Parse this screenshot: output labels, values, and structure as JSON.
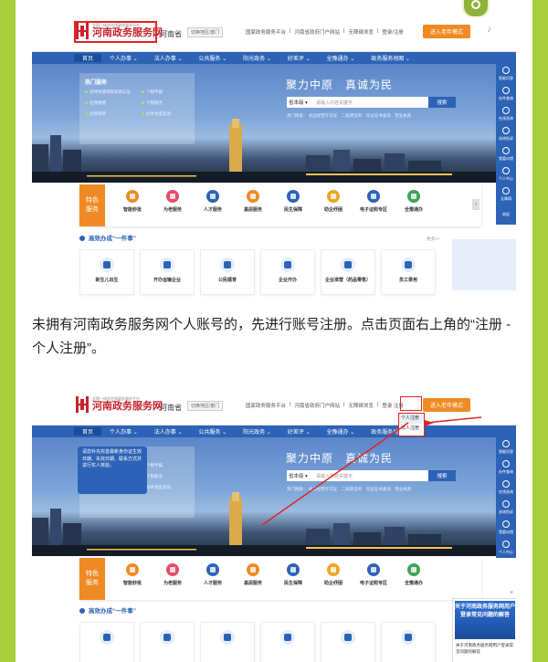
{
  "header": {
    "logo_tagline": "全国一体化在线政务服务平台",
    "logo_name": "河南政务服务网",
    "region": "河南省",
    "region_select": "切换地区/部门",
    "top_links": [
      "国家政务服务平台",
      "河南省政府门户网站",
      "无障碍浏览",
      "登录",
      "注册"
    ],
    "elder_mode": "进入老年模式"
  },
  "registration_dropdown": [
    "个人注册",
    "法人注册"
  ],
  "nav": [
    "首页",
    "个人办事 ⌄",
    "法人办事 ⌄",
    "公共服务 ⌄",
    "阳光政务 ⌄",
    "好差评 ⌄",
    "全豫通办 ⌄",
    "政务服务地图 ⌄"
  ],
  "hero": {
    "slogan": "聚力中原　真诚为民",
    "search_scope": "省本级 ▾",
    "search_placeholder": "请输入内容关键字",
    "search_button": "搜索",
    "hot_search": "热门搜索：  食品经营许可证　二级建造师　毕业证书查询　营业执照"
  },
  "hot_services": {
    "title": "热门服务",
    "items": [
      "退休待遇领取资格认证",
      "个税申报",
      "社保缴费",
      "个税服务",
      "社保转移",
      "办件进度查询"
    ]
  },
  "tip_popup": "请您补充完善最新身份证生效日期、失效日期、联系方式并进行实人核验。",
  "right_rail": [
    "智能问答",
    "办件查询",
    "在线咨询",
    "咨询投诉",
    "我要纠错",
    "个人中心",
    "无障碍",
    "收起"
  ],
  "featured": {
    "label": "特色\n服务",
    "items": [
      "智能秒批",
      "为老服务",
      "人才服务",
      "基层服务",
      "民生保障",
      "助企纾困",
      "电子证照专区",
      "全豫通办"
    ]
  },
  "efficient": {
    "title": "高效办成“一件事”",
    "more": "更多>>",
    "cards": [
      "新生儿出生",
      "开办运输企业",
      "公民婚育",
      "企业开办",
      "企业准营（药品零售）",
      "员工录用"
    ]
  },
  "caption": "未拥有河南政务服务网个人账号的，先进行账号注册。点击页面右上角的“注册 - 个人注册”。",
  "faq_popup": {
    "banner": "关于河南政务服务网用户登录常见问题的解答",
    "text": "关于河南政务服务网用户登录常见问题的解答"
  },
  "colors": {
    "brand_blue": "#2d63b6",
    "accent_orange": "#f08a24",
    "logo_red": "#c8232c",
    "page_bg": "#a8cf3c"
  }
}
